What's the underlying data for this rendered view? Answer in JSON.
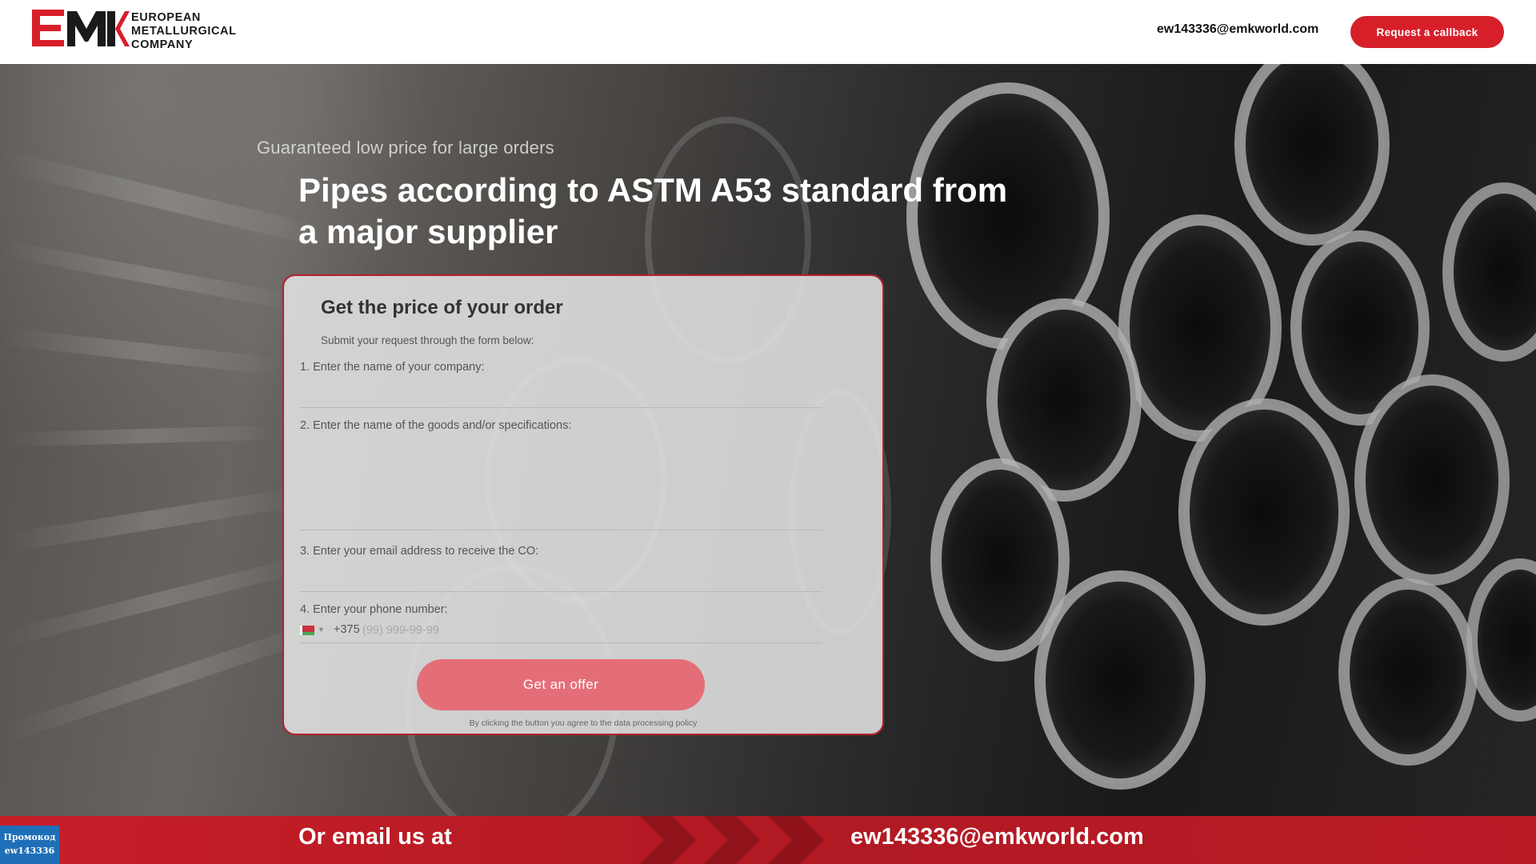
{
  "header": {
    "logo_text_lines": [
      "EUROPEAN",
      "METALLURGICAL",
      "COMPANY"
    ],
    "email": "ew143336@emkworld.com",
    "callback_label": "Request a callback"
  },
  "hero": {
    "subtitle": "Guaranteed low price for large orders",
    "title": "Pipes according to ASTM A53 standard from a major supplier"
  },
  "form": {
    "title": "Get the price of your order",
    "subtitle": "Submit your request through the form below:",
    "fields": [
      {
        "label": "1. Enter the name of your company:",
        "value": ""
      },
      {
        "label": "2. Enter the name of the goods and/or specifications:",
        "value": ""
      },
      {
        "label": "3. Enter your email address to receive the CO:",
        "value": ""
      },
      {
        "label": "4. Enter your phone number:",
        "value": ""
      }
    ],
    "phone": {
      "country_code": "+375",
      "placeholder": "(99) 999-99-99",
      "flag": "belarus-flag-icon"
    },
    "submit_label": "Get an offer",
    "policy_text": "By clicking the button you agree to the data processing policy"
  },
  "footer": {
    "left_text": "Or email us at",
    "right_text": "ew143336@emkworld.com"
  },
  "promo": {
    "line1": "Промокод",
    "line2": "ew143336"
  },
  "colors": {
    "accent": "#d71f2a",
    "button_faded": "#e46e78",
    "promo_blue": "#1f6fb8",
    "footer_red": "#c81e28"
  }
}
